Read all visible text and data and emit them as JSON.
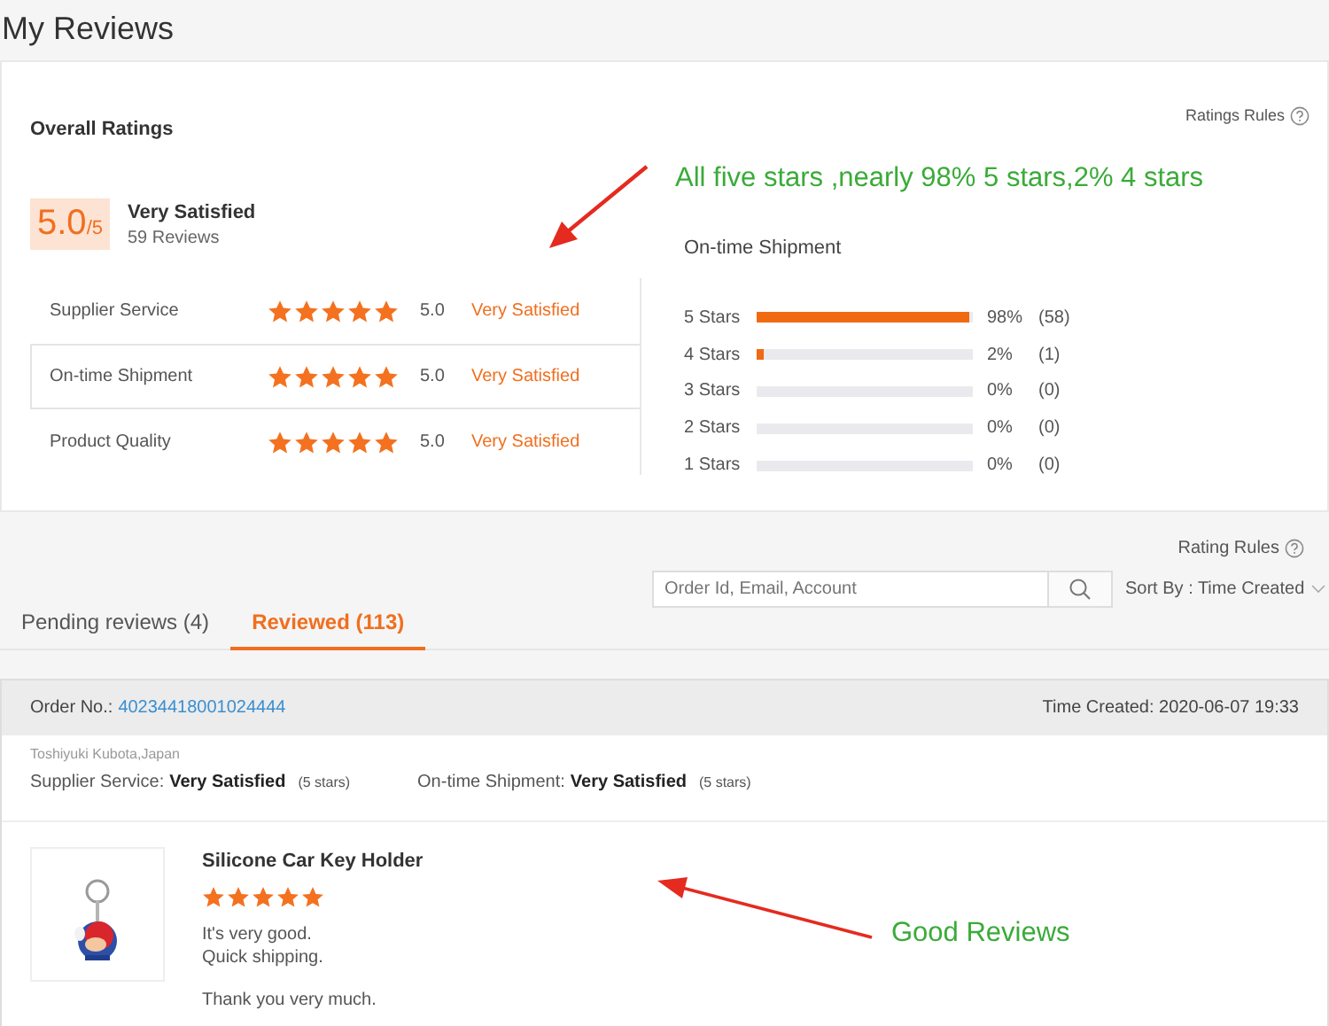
{
  "page": {
    "title": "My Reviews"
  },
  "overall": {
    "title": "Overall Ratings",
    "rules_link": "Ratings Rules",
    "score": "5.0",
    "score_max": "/5",
    "verdict": "Very Satisfied",
    "review_count": "59 Reviews",
    "categories": [
      {
        "name": "Supplier Service",
        "stars": 5,
        "score": "5.0",
        "verdict": "Very Satisfied",
        "selected": false
      },
      {
        "name": "On-time Shipment",
        "stars": 5,
        "score": "5.0",
        "verdict": "Very Satisfied",
        "selected": true
      },
      {
        "name": "Product Quality",
        "stars": 5,
        "score": "5.0",
        "verdict": "Very Satisfied",
        "selected": false
      }
    ],
    "distribution": {
      "title": "On-time Shipment",
      "rows": [
        {
          "label": "5 Stars",
          "level": 0.98,
          "percent": "98%",
          "count": "(58)"
        },
        {
          "label": "4 Stars",
          "level": 0.02,
          "percent": "2%",
          "count": "(1)"
        },
        {
          "label": "3 Stars",
          "level": 0,
          "percent": "0%",
          "count": "(0)"
        },
        {
          "label": "2 Stars",
          "level": 0,
          "percent": "0%",
          "count": "(0)"
        },
        {
          "label": "1 Stars",
          "level": 0,
          "percent": "0%",
          "count": "(0)"
        }
      ]
    }
  },
  "reviews": {
    "rules_link": "Rating Rules",
    "tabs": [
      {
        "label": "Pending reviews (4)",
        "selected": false
      },
      {
        "label": "Reviewed (113)",
        "selected": true
      }
    ],
    "search": {
      "placeholder": "Order Id, Email, Account"
    },
    "sort": "Sort By : Time Created"
  },
  "orders": [
    {
      "order_label": "Order No.:",
      "order_number": "40234418001024444",
      "time_created": "Time Created: 2020-06-07 19:33",
      "buyer": "Toshiyuki Kubota,Japan",
      "ratings": [
        {
          "label": "Supplier Service:",
          "verdict": "Very Satisfied",
          "stars_text": "(5 stars)"
        },
        {
          "label": "On-time Shipment:",
          "verdict": "Very Satisfied",
          "stars_text": "(5 stars)"
        }
      ],
      "product": {
        "kind": "picture",
        "title": "Silicone Car Key Holder",
        "stars": 5,
        "comment": [
          "It's very good.\nQuick shipping.",
          "Thank you very much."
        ]
      }
    }
  ],
  "annotations": [
    {
      "text": "All five stars ,nearly 98% 5 stars,2% 4 stars"
    },
    {
      "text": "Good Reviews"
    }
  ]
}
